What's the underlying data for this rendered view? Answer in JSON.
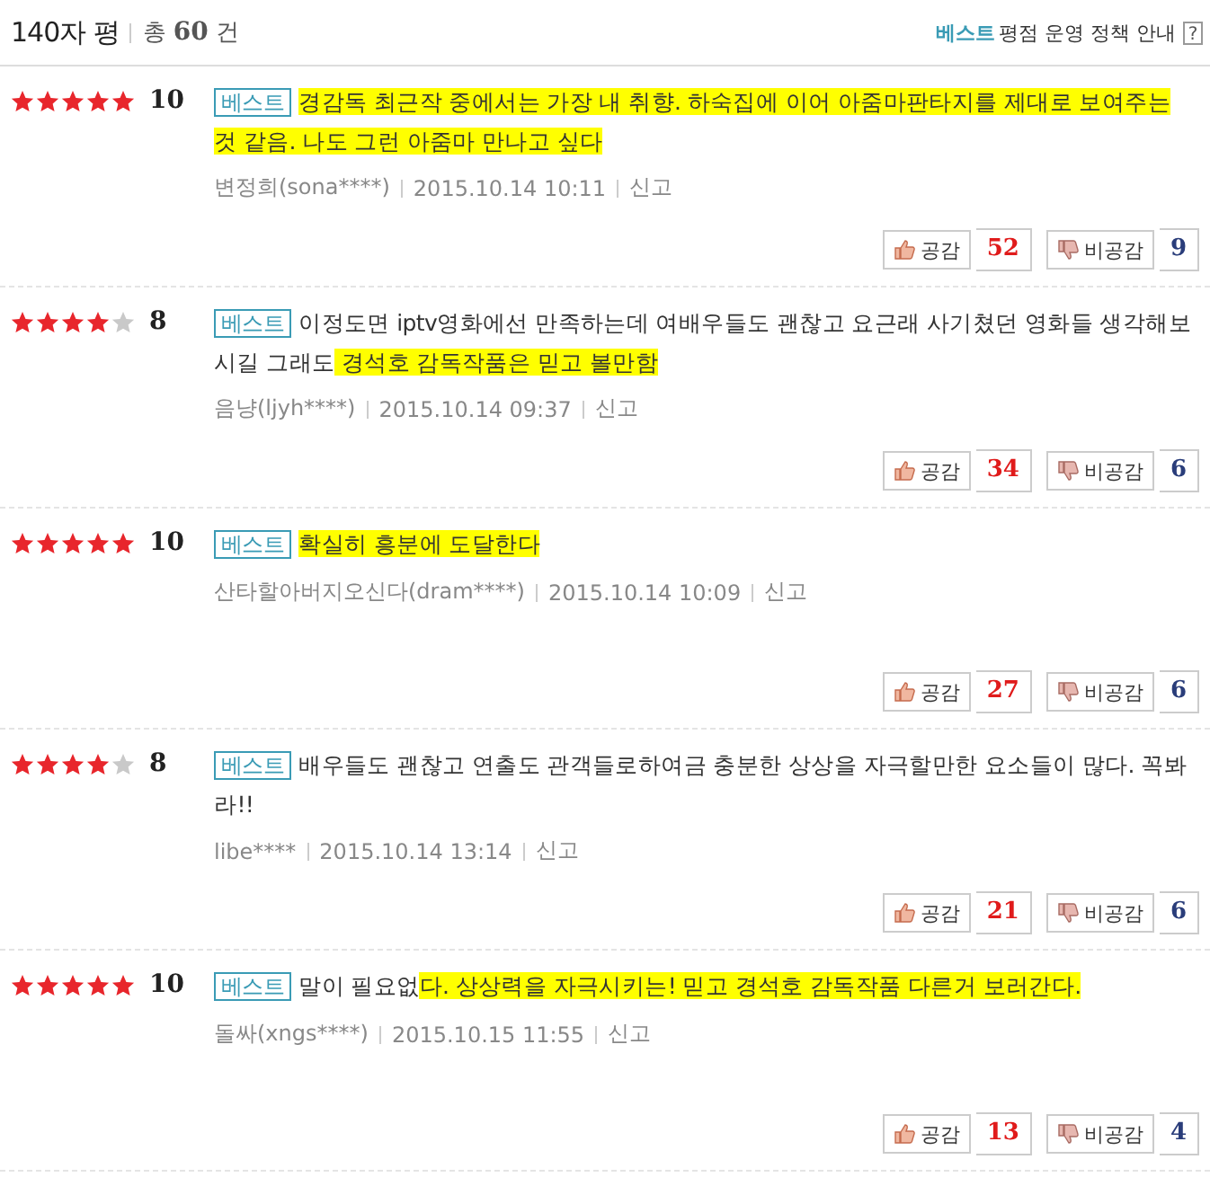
{
  "header": {
    "title": "140자 평",
    "total_prefix": "총",
    "total_count": "60",
    "total_suffix": "건",
    "policy_badge": "베스트",
    "policy_link": "평점 운영 정책 안내",
    "help": "?"
  },
  "reviews": [
    {
      "stars": 5,
      "score": "10",
      "badge": "베스트",
      "segments": [
        {
          "text": "경감독 최근작 중에서는 가장 내 취향. 하숙집에 이어 아줌마판타지를 제대로 보여주는 것 같음. 나도 그런 아줌마 만나고 싶다",
          "highlighted": true
        }
      ],
      "author": "변정희(sona****)",
      "date": "2015.10.14 10:11",
      "report": "신고",
      "like_label": "공감",
      "likes": "52",
      "dislike_label": "비공감",
      "dislikes": "9"
    },
    {
      "stars": 4,
      "score": "8",
      "badge": "베스트",
      "segments": [
        {
          "text": "이정도면 iptv영화에선 만족하는데 여배우들도 괜찮고 요근래 사기쳤던 영화들 생각해보시길 그래도",
          "highlighted": false
        },
        {
          "text": " 경석호 감독작품은 믿고 볼만함",
          "highlighted": true
        }
      ],
      "author": "음냥(ljyh****)",
      "date": "2015.10.14 09:37",
      "report": "신고",
      "like_label": "공감",
      "likes": "34",
      "dislike_label": "비공감",
      "dislikes": "6"
    },
    {
      "stars": 5,
      "score": "10",
      "badge": "베스트",
      "segments": [
        {
          "text": "확실히 흥분에 도달한다",
          "highlighted": true
        }
      ],
      "author": "산타할아버지오신다(dram****)",
      "date": "2015.10.14 10:09",
      "report": "신고",
      "like_label": "공감",
      "likes": "27",
      "dislike_label": "비공감",
      "dislikes": "6"
    },
    {
      "stars": 4,
      "score": "8",
      "badge": "베스트",
      "segments": [
        {
          "text": "배우들도 괜찮고 연출도 관객들로하여금 충분한 상상을 자극할만한 요소들이 많다. 꼭봐라!!",
          "highlighted": false
        }
      ],
      "author": "libe****",
      "date": "2015.10.14 13:14",
      "report": "신고",
      "like_label": "공감",
      "likes": "21",
      "dislike_label": "비공감",
      "dislikes": "6"
    },
    {
      "stars": 5,
      "score": "10",
      "badge": "베스트",
      "segments": [
        {
          "text": "말이 필요없",
          "highlighted": false
        },
        {
          "text": "다. 상상력을 자극시키는! 믿고 경석호 감독작품 다른거 보러간다.",
          "highlighted": true
        }
      ],
      "author": "돌싸(xngs****)",
      "date": "2015.10.15 11:55",
      "report": "신고",
      "like_label": "공감",
      "likes": "13",
      "dislike_label": "비공감",
      "dislikes": "4"
    }
  ]
}
